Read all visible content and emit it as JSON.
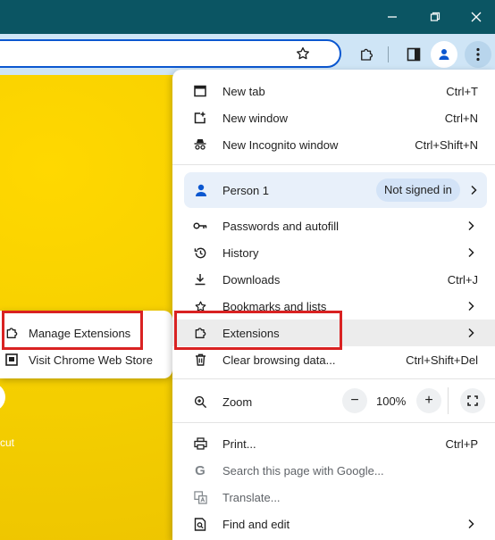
{
  "window": {
    "minimize_icon": "minimize-icon",
    "restore_icon": "restore-icon",
    "close_icon": "close-icon"
  },
  "toolbar": {
    "bookmark_icon": "star-icon",
    "extensions_icon": "puzzle-icon",
    "side_panel_icon": "side-panel-icon",
    "profile_icon": "person-icon",
    "menu_icon": "kebab-menu-icon"
  },
  "page": {
    "shortcut_label": "cut"
  },
  "submenu": {
    "items": [
      {
        "label": "Manage Extensions",
        "icon": "puzzle-icon"
      },
      {
        "label": "Visit Chrome Web Store",
        "icon": "web-store-icon"
      }
    ]
  },
  "menu": {
    "new_tab": {
      "label": "New tab",
      "shortcut": "Ctrl+T"
    },
    "new_window": {
      "label": "New window",
      "shortcut": "Ctrl+N"
    },
    "new_incognito": {
      "label": "New Incognito window",
      "shortcut": "Ctrl+Shift+N"
    },
    "profile": {
      "label": "Person 1",
      "status": "Not signed in"
    },
    "passwords": {
      "label": "Passwords and autofill"
    },
    "history": {
      "label": "History"
    },
    "downloads": {
      "label": "Downloads",
      "shortcut": "Ctrl+J"
    },
    "bookmarks": {
      "label": "Bookmarks and lists"
    },
    "extensions": {
      "label": "Extensions"
    },
    "clear_data": {
      "label": "Clear browsing data...",
      "shortcut": "Ctrl+Shift+Del"
    },
    "zoom": {
      "label": "Zoom",
      "minus": "−",
      "value": "100%",
      "plus": "+"
    },
    "print": {
      "label": "Print...",
      "shortcut": "Ctrl+P"
    },
    "search_page": {
      "label": "Search this page with Google..."
    },
    "translate": {
      "label": "Translate..."
    },
    "find_edit": {
      "label": "Find and edit"
    }
  },
  "colors": {
    "titlebar": "#0b5563",
    "toolbar": "#cfe5f6",
    "highlight_box": "#d92222",
    "page_background": "#f4ce00"
  }
}
